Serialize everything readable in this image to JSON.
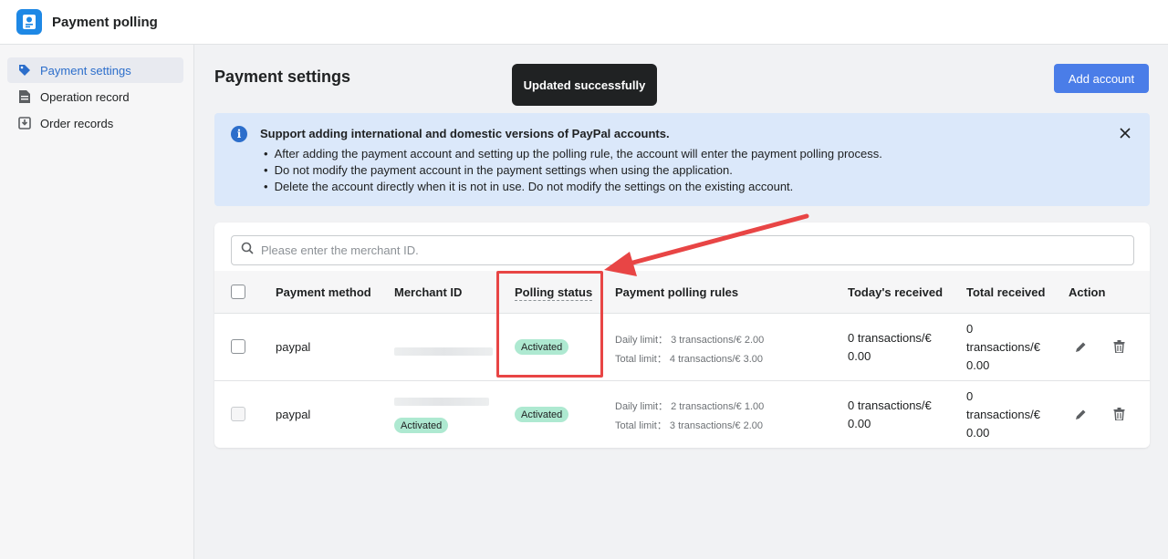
{
  "app": {
    "title": "Payment polling"
  },
  "sidebar": {
    "items": [
      {
        "label": "Payment settings",
        "active": true
      },
      {
        "label": "Operation record",
        "active": false
      },
      {
        "label": "Order records",
        "active": false
      }
    ]
  },
  "page": {
    "title": "Payment settings",
    "add_button": "Add account"
  },
  "toast": {
    "message": "Updated successfully"
  },
  "banner": {
    "title": "Support adding international and domestic versions of PayPal accounts.",
    "items": [
      "After adding the payment account and setting up the polling rule, the account will enter the payment polling process.",
      "Do not modify the payment account in the payment settings when using the application.",
      "Delete the account directly when it is not in use. Do not modify the settings on the existing account."
    ]
  },
  "search": {
    "placeholder": "Please enter the merchant ID."
  },
  "table": {
    "headers": {
      "method": "Payment method",
      "merchant": "Merchant ID",
      "status": "Polling status",
      "rules": "Payment polling rules",
      "today": "Today's received",
      "total": "Total received",
      "action": "Action"
    },
    "rows": [
      {
        "method": "paypal",
        "merchant_badge": "",
        "status": "Activated",
        "daily": "Daily limit： 3 transactions/€ 2.00",
        "total_limit": "Total limit： 4 transactions/€ 3.00",
        "today_1": "0 transactions/€",
        "today_2": "0.00",
        "total_1": "0",
        "total_2": "transactions/€",
        "total_3": "0.00"
      },
      {
        "method": "paypal",
        "merchant_badge": "Activated",
        "status": "Activated",
        "daily": "Daily limit： 2 transactions/€ 1.00",
        "total_limit": "Total limit： 3 transactions/€ 2.00",
        "today_1": "0 transactions/€",
        "today_2": "0.00",
        "total_1": "0",
        "total_2": "transactions/€",
        "total_3": "0.00"
      }
    ]
  },
  "colors": {
    "accent": "#4a7de8",
    "badge": "#aee9d1",
    "banner": "#dbe8fa",
    "annotation": "#e84545"
  }
}
